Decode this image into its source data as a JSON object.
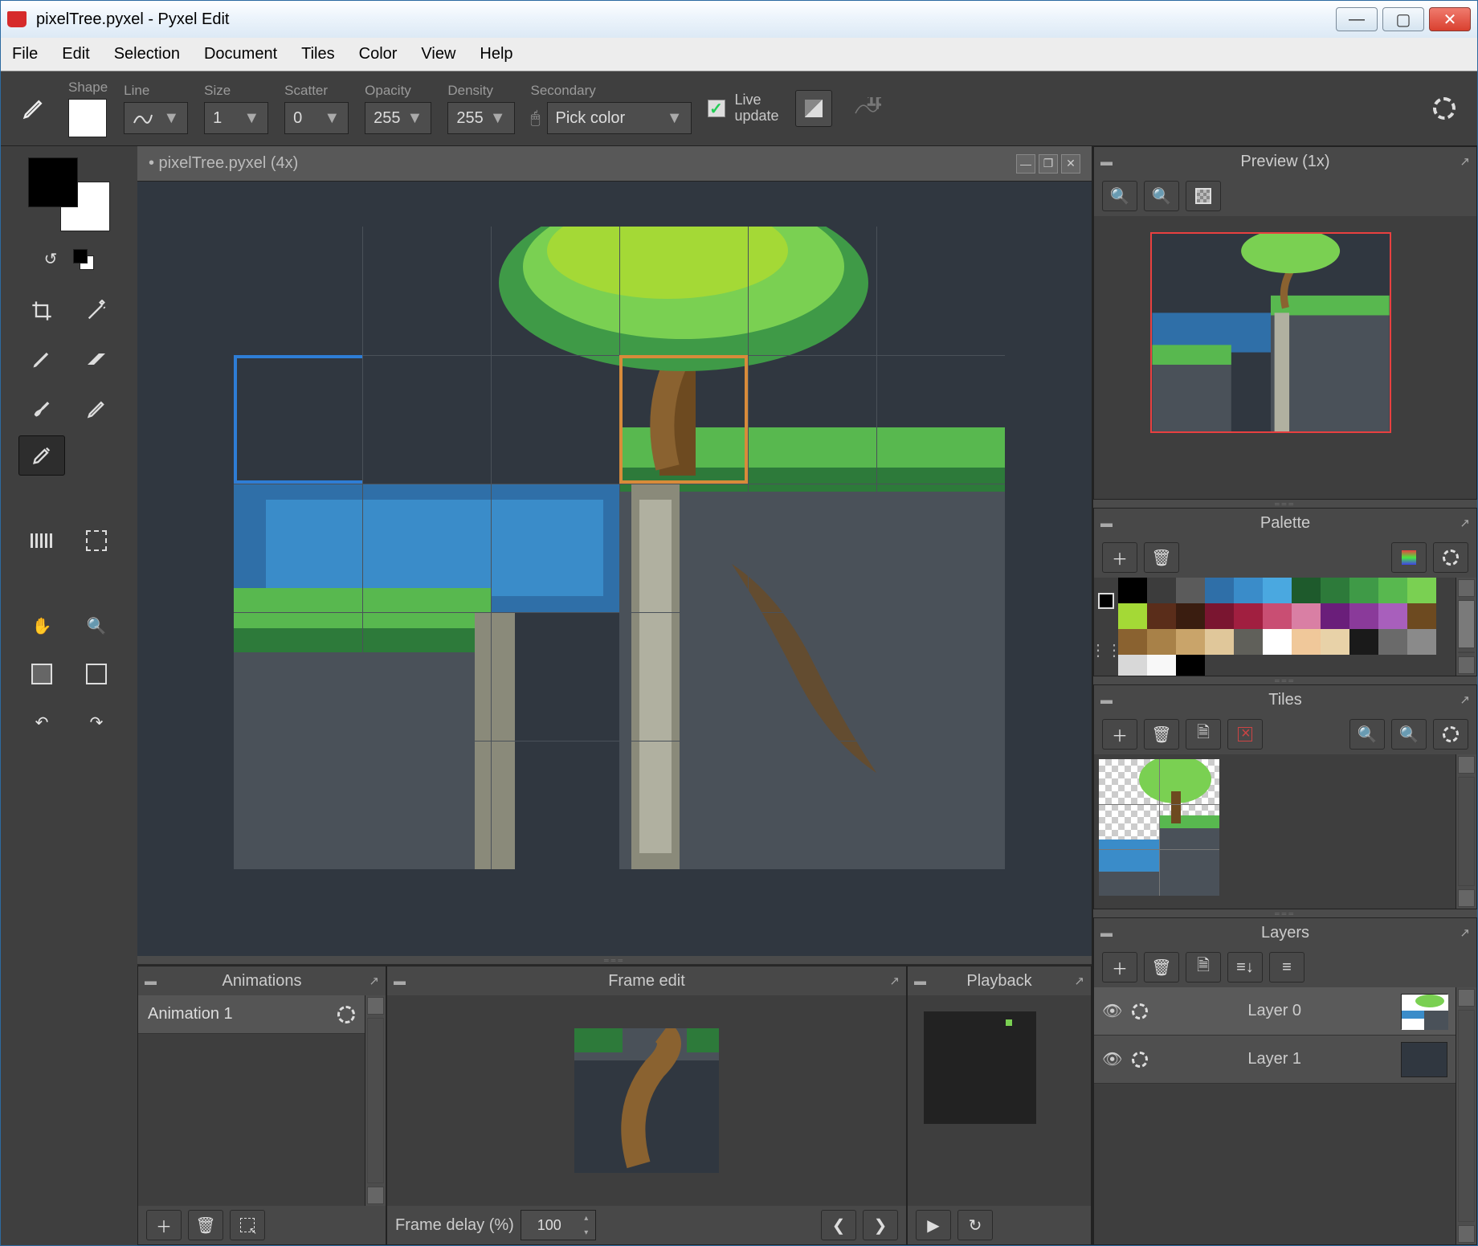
{
  "window": {
    "title": "pixelTree.pyxel - Pyxel Edit"
  },
  "menu": [
    "File",
    "Edit",
    "Selection",
    "Document",
    "Tiles",
    "Color",
    "View",
    "Help"
  ],
  "toolbar": {
    "shape_label": "Shape",
    "line_label": "Line",
    "size_label": "Size",
    "scatter_label": "Scatter",
    "opacity_label": "Opacity",
    "density_label": "Density",
    "secondary_label": "Secondary",
    "size": "1",
    "scatter": "0",
    "opacity": "255",
    "density": "255",
    "secondary": "Pick color",
    "live_update": "Live\nupdate"
  },
  "document": {
    "tab": "• pixelTree.pyxel   (4x)"
  },
  "panels": {
    "preview": "Preview (1x)",
    "palette": "Palette",
    "tiles": "Tiles",
    "layers": "Layers",
    "animations": "Animations",
    "frame_edit": "Frame edit",
    "playback": "Playback"
  },
  "animations": {
    "item": "Animation 1"
  },
  "frame": {
    "delay_label": "Frame delay (%)",
    "delay_value": "100"
  },
  "layers": [
    "Layer 0",
    "Layer 1"
  ],
  "palette_colors": [
    "#000000",
    "#3c3c3c",
    "#5b5b5b",
    "#2f6fa8",
    "#3a8cc9",
    "#4aa8e0",
    "#1e5a2c",
    "#2d7a3a",
    "#3f9a47",
    "#58b84f",
    "#7ad052",
    "#a4d936",
    "#5a2d1a",
    "#3a1d10",
    "#7a1530",
    "#a11f40",
    "#c94e73",
    "#d97fa4",
    "#6a1e7a",
    "#8a3a9a",
    "#a85fbc",
    "#6d4a20",
    "#8a6230",
    "#a88148",
    "#c9a46a",
    "#e0c79a",
    "#60605a",
    "#ffffff",
    "#f0c89a",
    "#e8d2a8",
    "#1a1a1a",
    "#6a6a6a",
    "#8a8a8a",
    "#d8d8d8",
    "#f8f8f8",
    "#000000"
  ]
}
